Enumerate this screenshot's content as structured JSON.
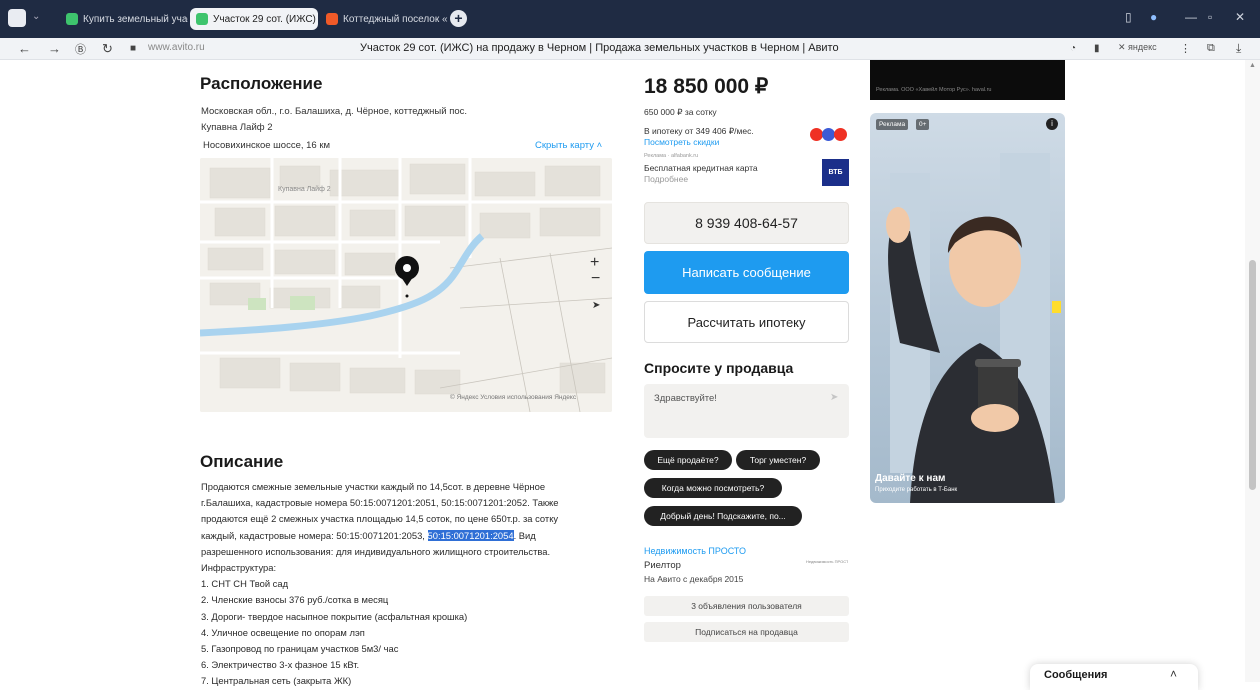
{
  "browser": {
    "tabs": [
      {
        "label": "Купить земельный участ",
        "color": "#3ec46d"
      },
      {
        "label": "Участок 29 сот. (ИЖС)",
        "color": "#3ec46d"
      },
      {
        "label": "Коттеджный поселок «Ку",
        "color": "#f05a28"
      }
    ],
    "url": "www.avito.ru",
    "page_title": "Участок 29 сот. (ИЖС) на продажу в Черном | Продажа земельных участков в Черном | Авито",
    "yandex_label": "яндекс"
  },
  "location": {
    "heading": "Расположение",
    "address_line1": "Московская обл., г.о. Балашиха, д. Чёрное, коттеджный пос.",
    "address_line2": "Купавна Лайф 2",
    "highway": "Носовихинское шоссе, 16 км",
    "hide_map": "Скрыть карту",
    "map_place_label": "Купавна Лайф 2",
    "map_footer": "© Яндекс Условия использования Яндекс"
  },
  "description": {
    "heading": "Описание",
    "lines": [
      "Продаются смежные земельные участки каждый по 14,5сот. в деревне Чёрное",
      "г.Балашиха, кадастровые номера 50:15:0071201:2051, 50:15:0071201:2052. Также",
      "продаются ещё 2 смежных участка площадью 14,5 соток, по цене 650т.р. за сотку",
      "разрешенного использования: для индивидуального жилищного строительства.",
      "Инфраструктура:",
      "1. СНТ СН Твой сад",
      "2. Членские взносы 376 руб./сотка в месяц",
      "3. Дороги- твердое насыпное покрытие (асфальтная крошка)",
      "4. Уличное освещение по опорам лэп",
      "5. Газопровод по границам участков 5м3/ час",
      "6. Электричество 3-х фазное 15 кВт.",
      "7. Центральная сеть (закрыта ЖК)"
    ],
    "cadastral_line_prefix": "каждый, кадастровые номера: 50:15:0071201:2053, ",
    "cadastral_highlight": "50:15:0071201:2054",
    "cadastral_line_suffix": ". Вид"
  },
  "price": {
    "value": "18 850 000 ₽",
    "per_sotka": "650 000 ₽ за сотку",
    "mortgage": "В ипотеку от 349 406 ₽/мес.",
    "discounts": "Посмотреть скидки",
    "ad_small": "Реклама · alfabank.ru",
    "credit_card": "Бесплатная кредитная карта",
    "more": "Подробнее",
    "bank_logo": "ВТБ"
  },
  "actions": {
    "phone": "8 939 408-64-57",
    "write_message": "Написать сообщение",
    "calc_mortgage": "Рассчитать ипотеку"
  },
  "ask": {
    "heading": "Спросите у продавца",
    "placeholder": "Здравствуйте!",
    "chips": [
      "Ещё продаёте?",
      "Торг уместен?",
      "Когда можно посмотреть?",
      "Добрый день! Подскажите, по..."
    ]
  },
  "seller": {
    "name": "Недвижимость ПРОСТО",
    "role": "Риелтор",
    "since": "На Авито с декабря 2015",
    "logo_text": "Недвижимость ПРОСТО",
    "listings": "3 объявления пользователя",
    "subscribe": "Подписаться на продавца"
  },
  "ads": {
    "top_banner": "Реклама. ООО «Хавейл Мотор Рус». haval.ru",
    "badge": "Реклама",
    "age": "0+",
    "title": "Давайте к нам",
    "subtitle": "Приходите работать в Т-Банк"
  },
  "messages": {
    "label": "Сообщения"
  },
  "colors": {
    "accent_blue": "#1e9bf0",
    "chip_dark": "#222222",
    "highlight": "#2f6fd6"
  }
}
